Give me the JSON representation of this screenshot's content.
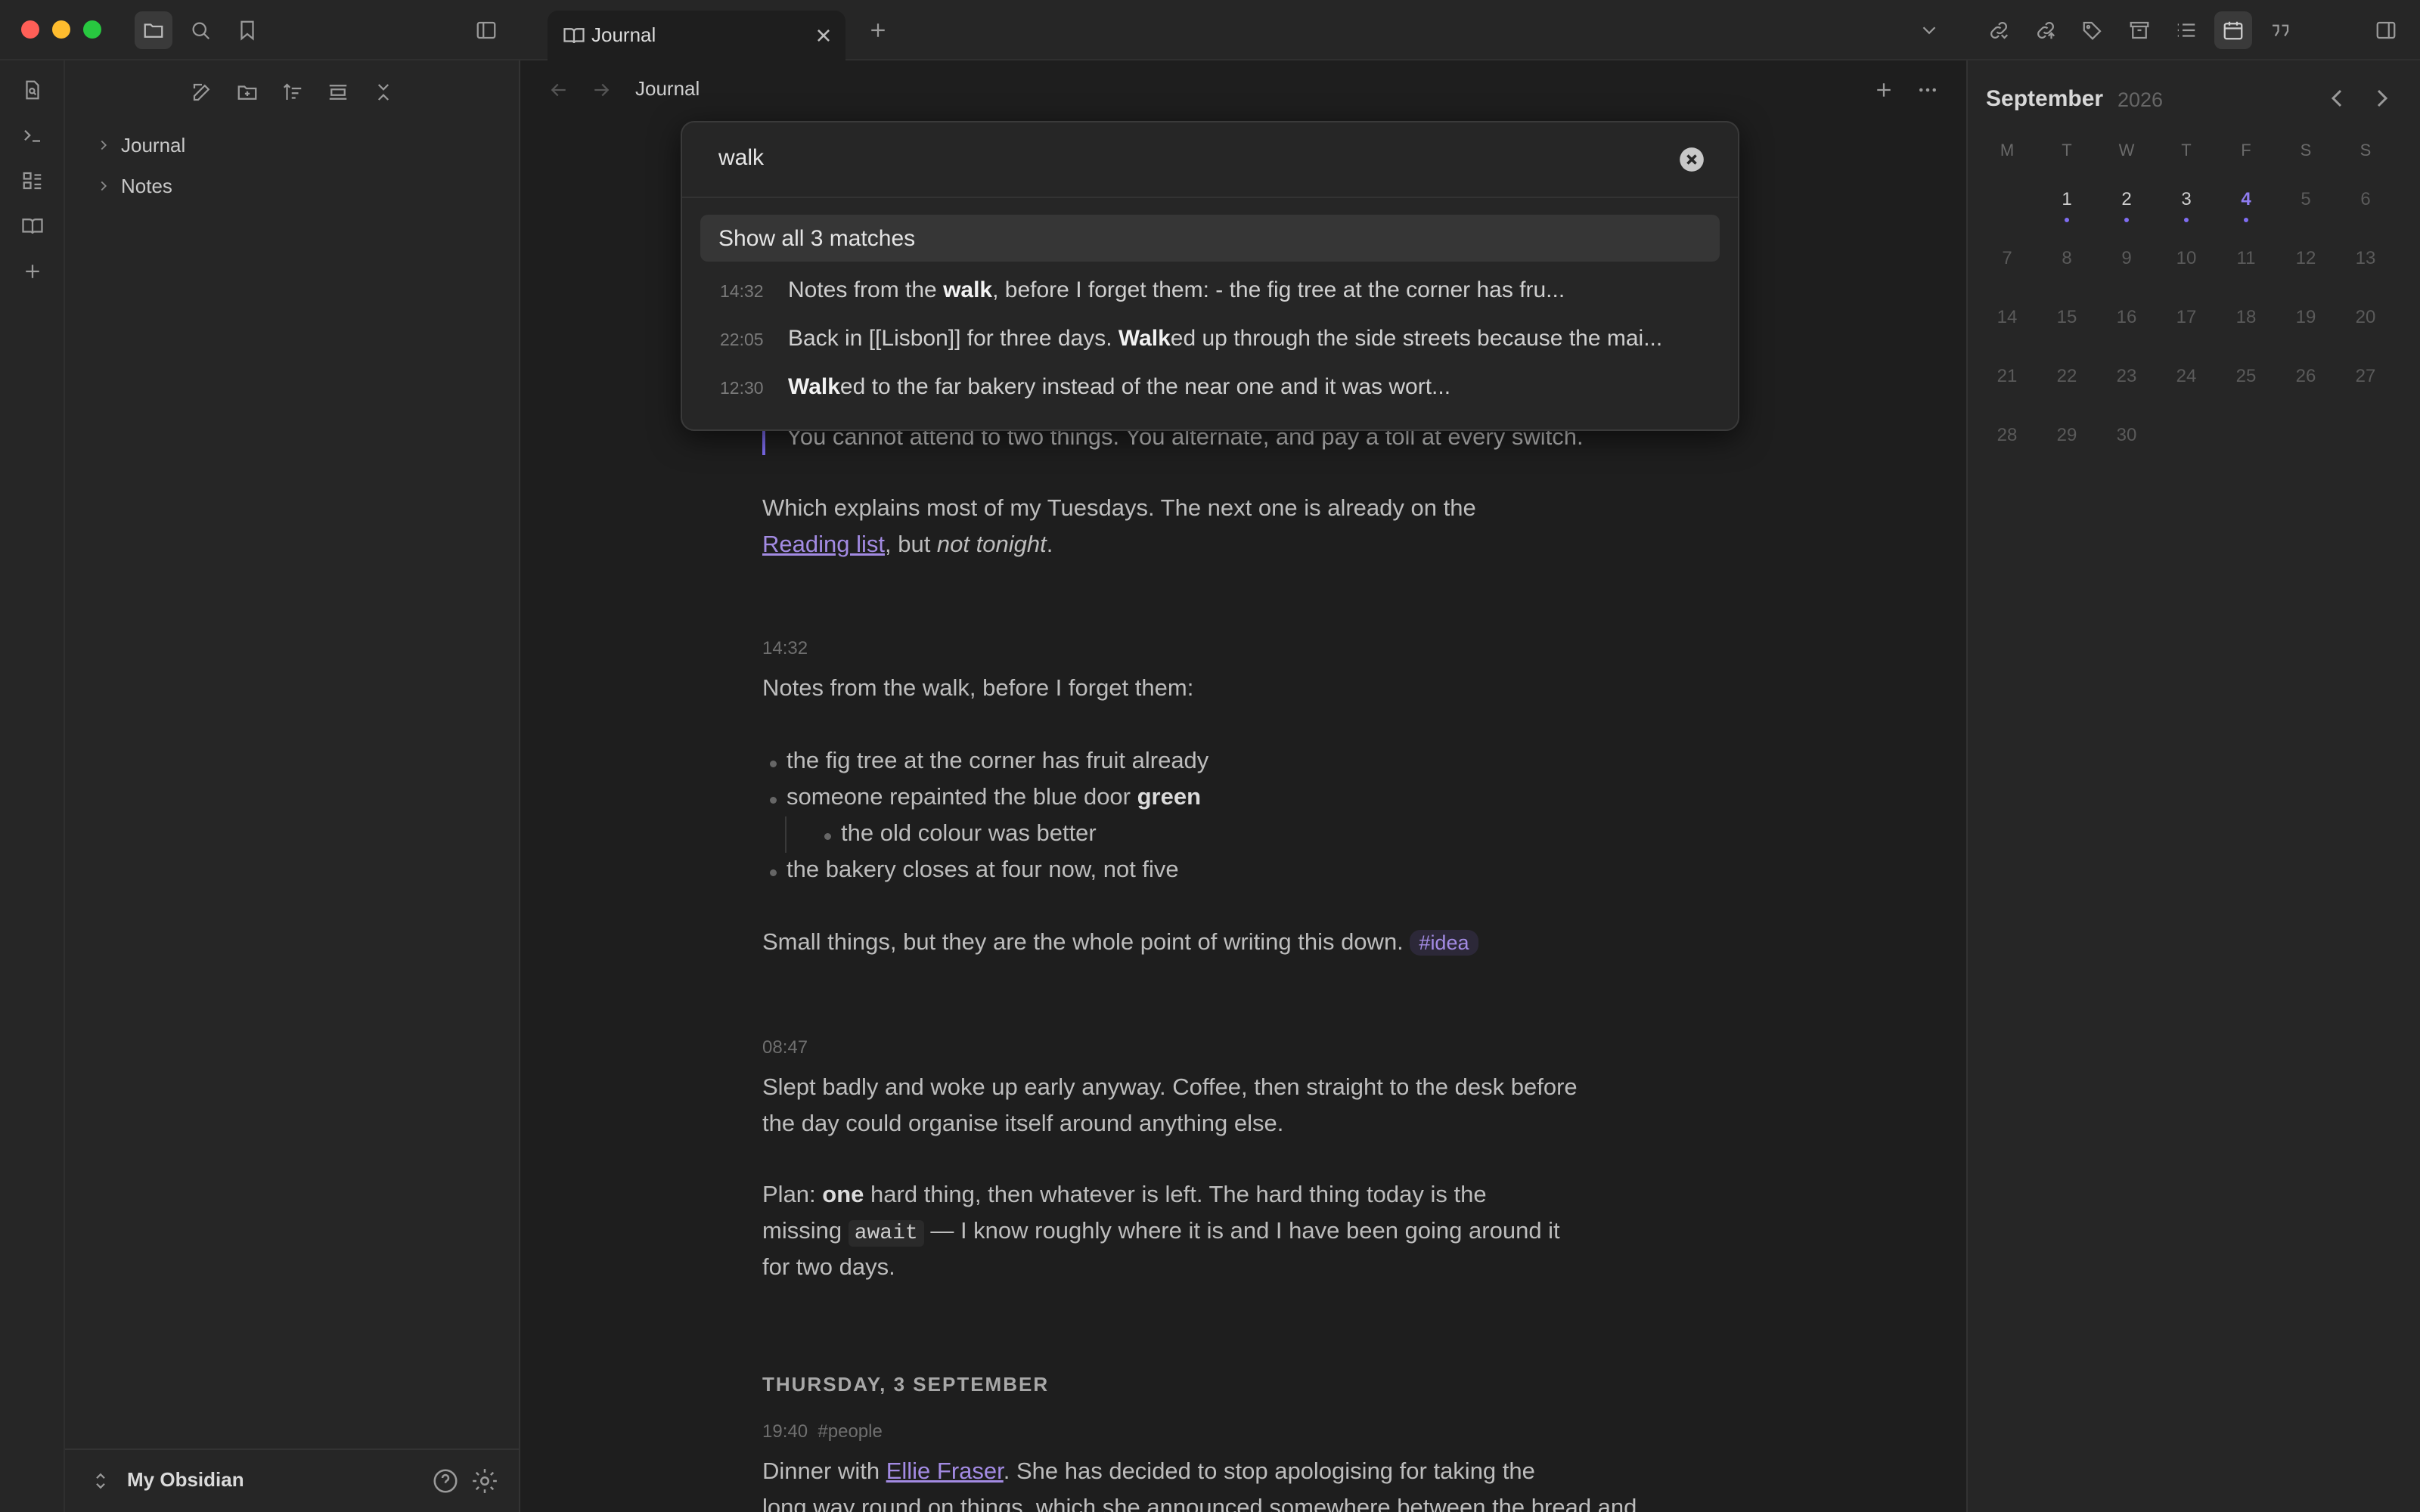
{
  "tabs": [
    {
      "label": "Journal"
    }
  ],
  "view": {
    "title": "Journal"
  },
  "sidebar": {
    "tree": [
      {
        "label": "Journal"
      },
      {
        "label": "Notes"
      }
    ],
    "vault": {
      "name": "My Obsidian"
    }
  },
  "search": {
    "query": "walk",
    "show_all": "Show all 3 matches",
    "results": [
      {
        "time": "14:32",
        "pre": "Notes from the ",
        "match": "walk",
        "post": ", before I forget them: - the fig tree at the corner has fru..."
      },
      {
        "time": "22:05",
        "pre": "Back in [[Lisbon]] for three days. ",
        "match": "Walk",
        "post": "ed up through the side streets because the mai..."
      },
      {
        "time": "12:30",
        "pre": "",
        "match": "Walk",
        "post": "ed to the far bakery instead of the near one and it was wort..."
      }
    ]
  },
  "note": {
    "quote_line": "You cannot attend to two things. You alternate, and pay a toll at every switch.",
    "p1_a": "Which explains most of my Tuesdays. The next one is already on the",
    "p1_link": "Reading list",
    "p1_b": ", but ",
    "p1_em": "not tonight",
    "p1_c": ".",
    "entry1": {
      "time": "14:32",
      "intro": "Notes from the walk, before I forget them:",
      "b1": "the fig tree at the corner has fruit already",
      "b2_a": "someone repainted the blue door ",
      "b2_bold": "green",
      "b3": "the old colour was better",
      "b4": "the bakery closes at four now, not five",
      "closing": "Small things, but they are the whole point of writing this down.",
      "tag": "#idea"
    },
    "entry2": {
      "time": "08:47",
      "l1": "Slept badly and woke up early anyway. Coffee, then straight to the desk before",
      "l2": "the day could organise itself around anything else.",
      "plan_a": "Plan: ",
      "plan_bold": "one",
      "plan_b": " hard thing, then whatever is left. The hard thing today is the",
      "l4_a": "missing ",
      "l4_code": "await",
      "l4_b": " — I know roughly where it is and I have been going around it",
      "l5": "for two days."
    },
    "day_heading": "THURSDAY, 3 SEPTEMBER",
    "entry3": {
      "time": "19:40",
      "tag": "#people",
      "l1_a": "Dinner with ",
      "l1_link": "Ellie Fraser",
      "l1_b": ". She has decided to stop apologising for taking the",
      "l2": "long way round on things, which she announced somewhere between the bread and"
    }
  },
  "calendar": {
    "month": "September",
    "year": "2026",
    "dow": [
      "M",
      "T",
      "W",
      "T",
      "F",
      "S",
      "S"
    ],
    "weeks": [
      [
        "",
        "1",
        "2",
        "3",
        "4",
        "5",
        "6"
      ],
      [
        "7",
        "8",
        "9",
        "10",
        "11",
        "12",
        "13"
      ],
      [
        "14",
        "15",
        "16",
        "17",
        "18",
        "19",
        "20"
      ],
      [
        "21",
        "22",
        "23",
        "24",
        "25",
        "26",
        "27"
      ],
      [
        "28",
        "29",
        "30",
        "",
        "",
        "",
        ""
      ]
    ],
    "today": "4",
    "dots": [
      "1",
      "2",
      "3",
      "4"
    ]
  },
  "colors": {
    "accent": "#7f6df2",
    "link": "#a38be3"
  }
}
